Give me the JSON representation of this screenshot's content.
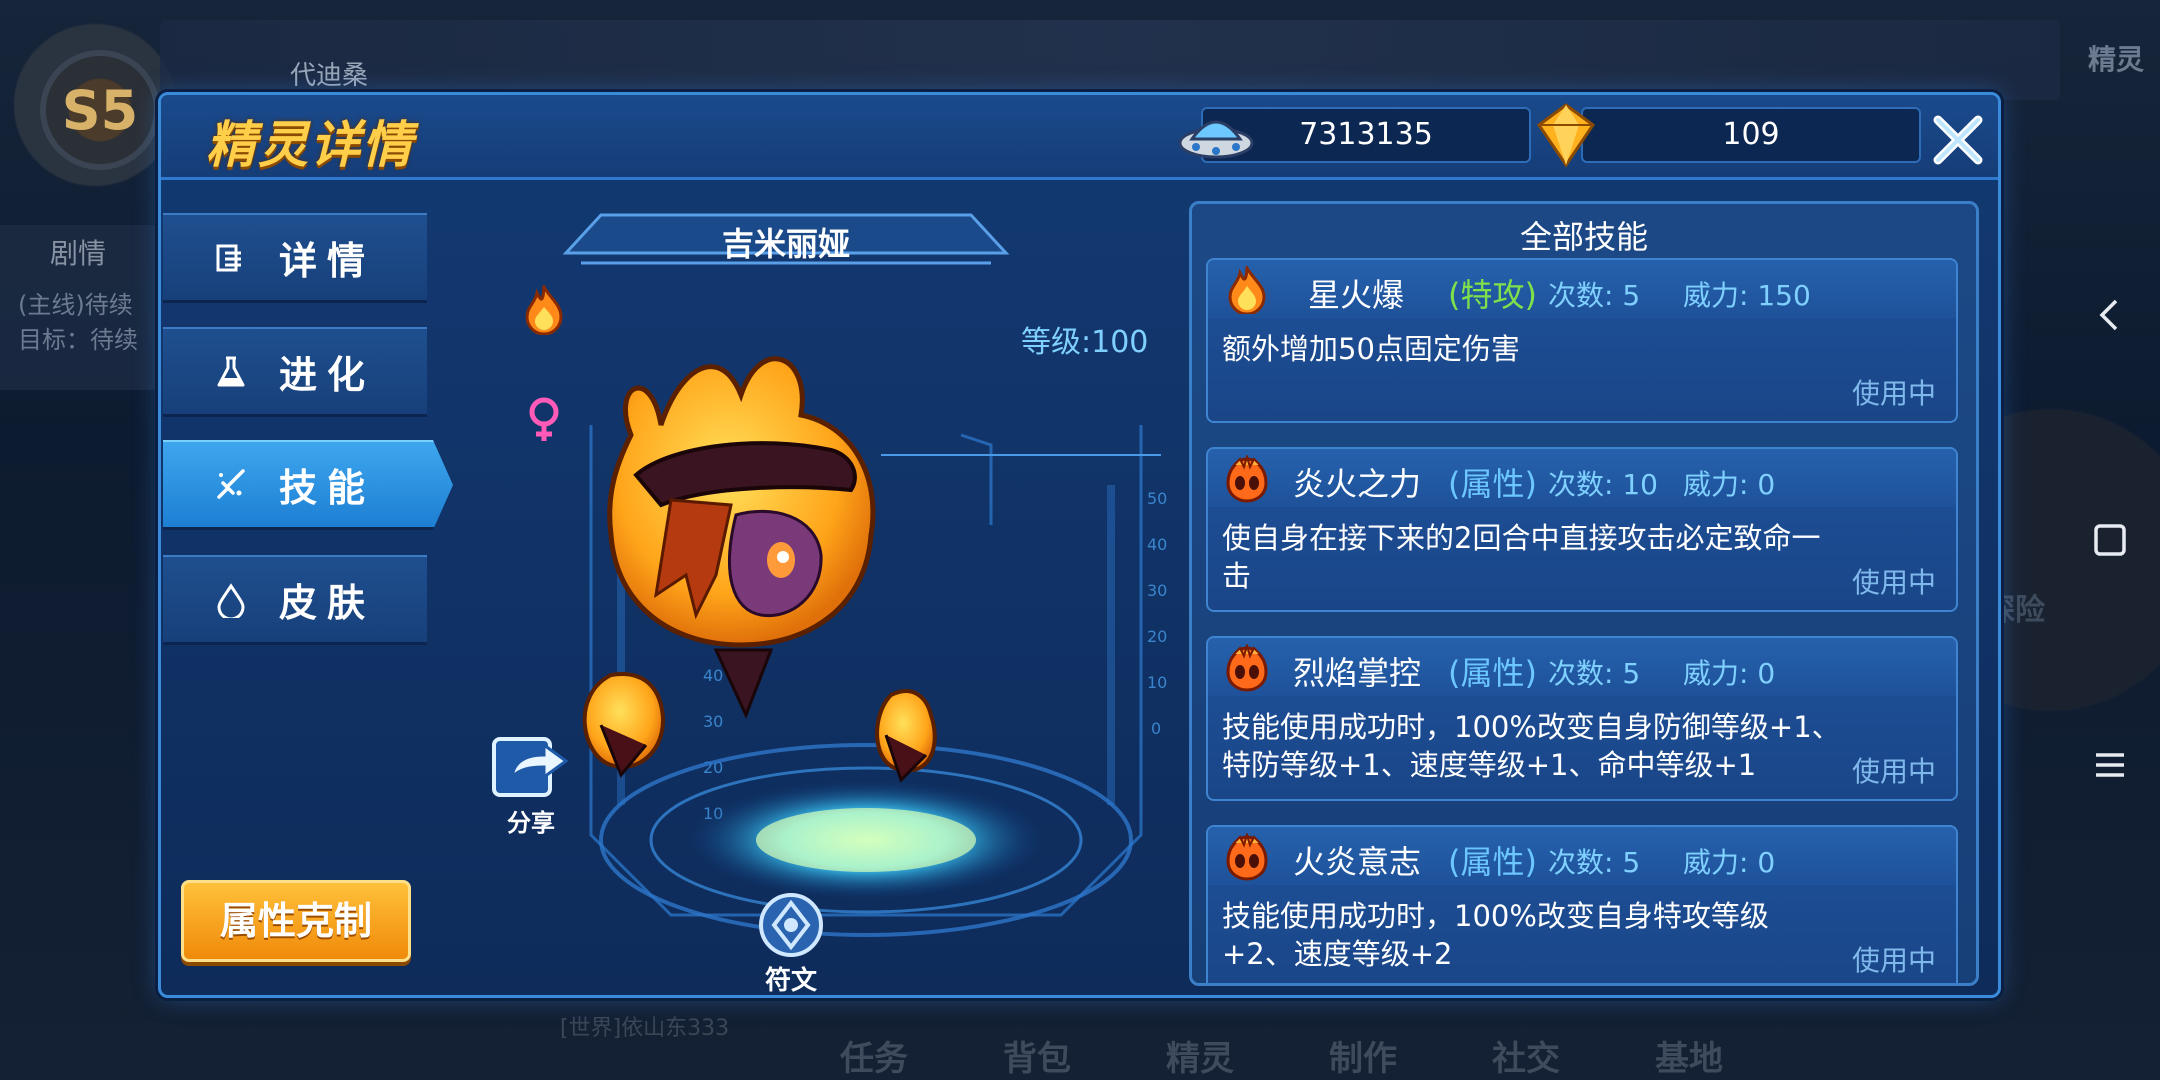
{
  "background": {
    "player_name": "代迪桑",
    "rank_badge": "S5",
    "story": {
      "title": "剧情",
      "line1": "(主线)待续",
      "line2": "目标：待续"
    },
    "bottom_nav": [
      "任务",
      "背包",
      "精灵",
      "制作",
      "社交",
      "基地"
    ],
    "explore": "探险",
    "world_chat": "[世界]依山东333",
    "spirit_tag": "精灵"
  },
  "header": {
    "title": "精灵详情",
    "currency_coins": "7313135",
    "currency_gems": "109"
  },
  "nav": {
    "details": "详情",
    "evolve": "进化",
    "skills": "技能",
    "skins": "皮肤"
  },
  "type_chart_button": "属性克制",
  "spirit": {
    "name": "吉米丽娅",
    "level": "等级:100"
  },
  "share_label": "分享",
  "rune_label": "符文",
  "skills": {
    "title": "全部技能",
    "list": [
      {
        "name": "星火爆",
        "category": "(特攻)",
        "category_color": "#7ee04a",
        "count": "次数: 5",
        "power": "威力: 150",
        "desc": "额外增加50点固定伤害",
        "status": "使用中",
        "icon": "fire-flame-icon"
      },
      {
        "name": "炎火之力",
        "category": "(属性)",
        "category_color": "#6cc6ff",
        "count": "次数: 10",
        "power": "威力: 0",
        "desc": "使自身在接下来的2回合中直接攻击必定致命一击",
        "status": "使用中",
        "icon": "fire-paw-icon"
      },
      {
        "name": "烈焰掌控",
        "category": "(属性)",
        "category_color": "#6cc6ff",
        "count": "次数: 5",
        "power": "威力: 0",
        "desc": "技能使用成功时，100%改变自身防御等级+1、特防等级+1、速度等级+1、命中等级+1",
        "status": "使用中",
        "icon": "fire-paw-icon"
      },
      {
        "name": "火炎意志",
        "category": "(属性)",
        "category_color": "#6cc6ff",
        "count": "次数: 5",
        "power": "威力: 0",
        "desc": "技能使用成功时，100%改变自身特攻等级+2、速度等级+2",
        "status": "使用中",
        "icon": "fire-paw-icon"
      }
    ]
  },
  "colors": {
    "accent": "#ffcf4a",
    "panel": "#133a73",
    "active_tab": "#3ea6ee"
  }
}
